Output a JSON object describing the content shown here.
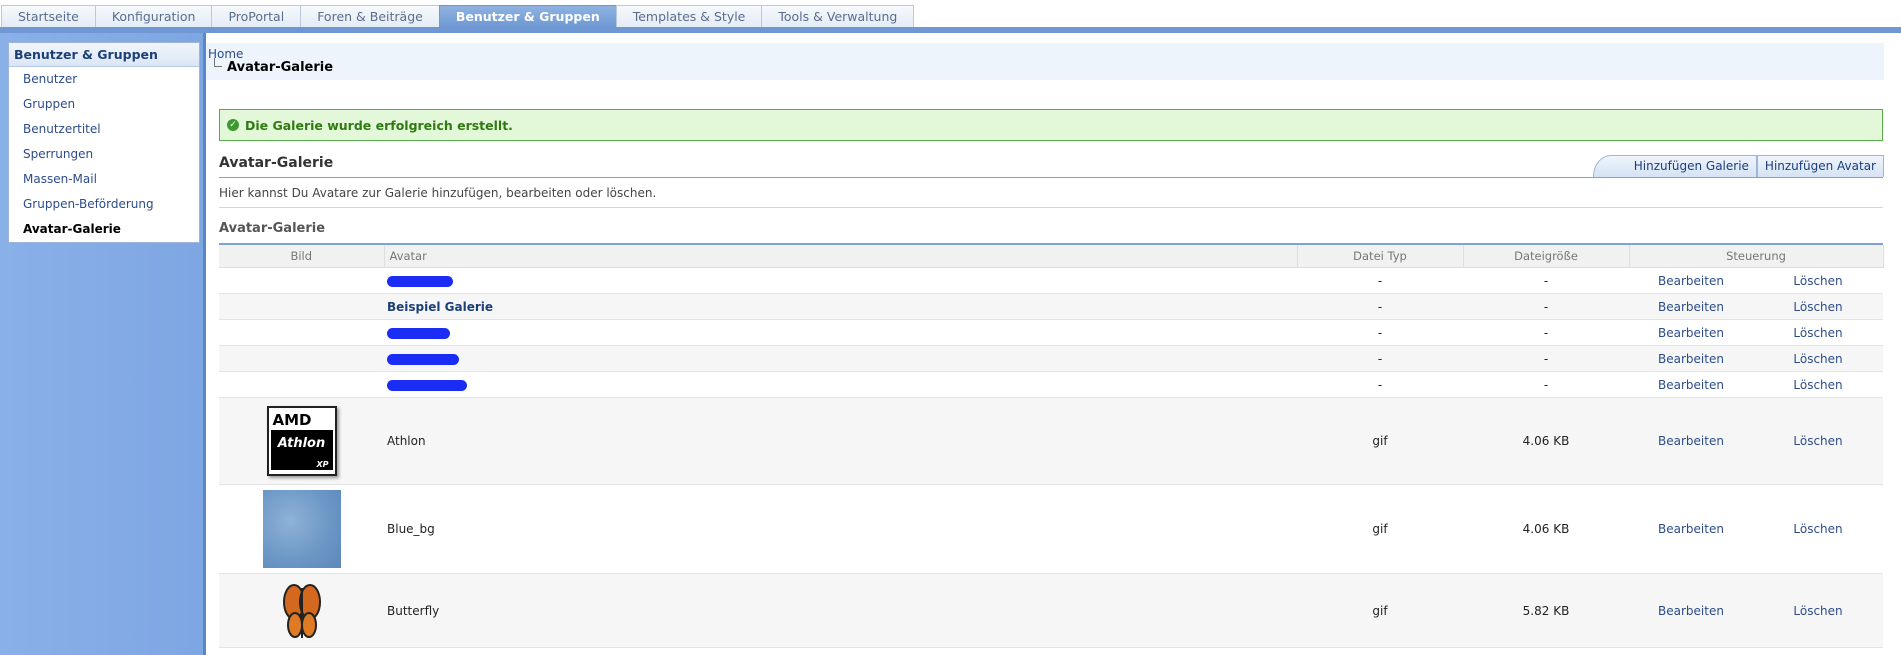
{
  "top_tabs": [
    "Startseite",
    "Konfiguration",
    "ProPortal",
    "Foren & Beiträge",
    "Benutzer & Gruppen",
    "Templates & Style",
    "Tools & Verwaltung"
  ],
  "active_tab": "Benutzer & Gruppen",
  "sidebar": {
    "title": "Benutzer & Gruppen",
    "items": [
      "Benutzer",
      "Gruppen",
      "Benutzertitel",
      "Sperrungen",
      "Massen-Mail",
      "Gruppen-Beförderung",
      "Avatar-Galerie"
    ],
    "active": "Avatar-Galerie"
  },
  "breadcrumb": {
    "home": "Home",
    "current": "Avatar-Galerie"
  },
  "success_message": "Die Galerie wurde erfolgreich erstellt.",
  "section": {
    "title": "Avatar-Galerie",
    "buttons": [
      "Hinzufügen Galerie",
      "Hinzufügen Avatar"
    ],
    "description": "Hier kannst Du Avatare zur Galerie hinzufügen, bearbeiten oder löschen."
  },
  "table": {
    "title": "Avatar-Galerie",
    "columns": [
      "Bild",
      "Avatar",
      "Datei Typ",
      "Dateigröße",
      "Steuerung"
    ],
    "edit_label": "Bearbeiten",
    "delete_label": "Löschen",
    "rows": [
      {
        "image": "",
        "avatar": "",
        "redacted": true,
        "type": "-",
        "size": "-"
      },
      {
        "image": "",
        "avatar": "Beispiel Galerie",
        "redacted": false,
        "type": "-",
        "size": "-"
      },
      {
        "image": "",
        "avatar": "",
        "redacted": true,
        "type": "-",
        "size": "-"
      },
      {
        "image": "",
        "avatar": "",
        "redacted": true,
        "type": "-",
        "size": "-"
      },
      {
        "image": "",
        "avatar": "",
        "redacted": true,
        "type": "-",
        "size": "-"
      },
      {
        "image": "amd-athlon-logo",
        "avatar": "Athlon",
        "redacted": false,
        "type": "gif",
        "size": "4.06 KB",
        "logo_text": [
          "AMD",
          "Athlon",
          "XP"
        ]
      },
      {
        "image": "blue-texture",
        "avatar": "Blue_bg",
        "redacted": false,
        "type": "gif",
        "size": "4.06 KB"
      },
      {
        "image": "butterfly",
        "avatar": "Butterfly",
        "redacted": false,
        "type": "gif",
        "size": "5.82 KB"
      }
    ]
  },
  "colors": {
    "tab_active": "#6e97d3",
    "sidebar_bg": "#8ab0e8",
    "link": "#2d4c8a",
    "success_bg": "#e2f8d8",
    "success_text": "#2f7a12",
    "redaction": "#1b2cf5"
  }
}
